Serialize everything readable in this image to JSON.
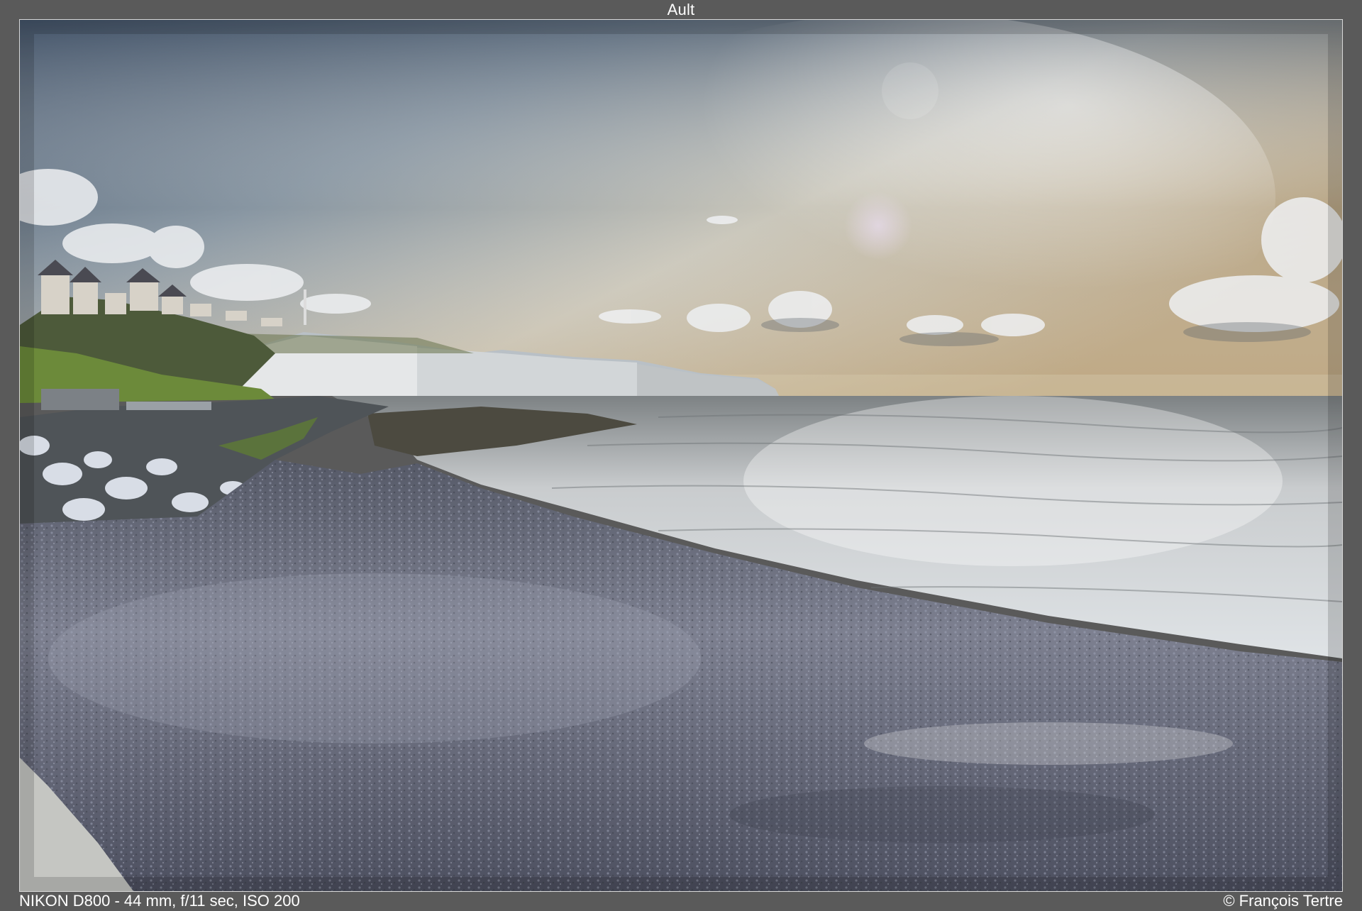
{
  "title": "Ault",
  "exif": "NIKON D800 - 44 mm, f/11 sec, ISO 200",
  "copyright": "© François Tertre",
  "colors": {
    "frame_background": "#5a5a5a",
    "text": "#ffffff",
    "photo_border": "#d8d8d8"
  }
}
